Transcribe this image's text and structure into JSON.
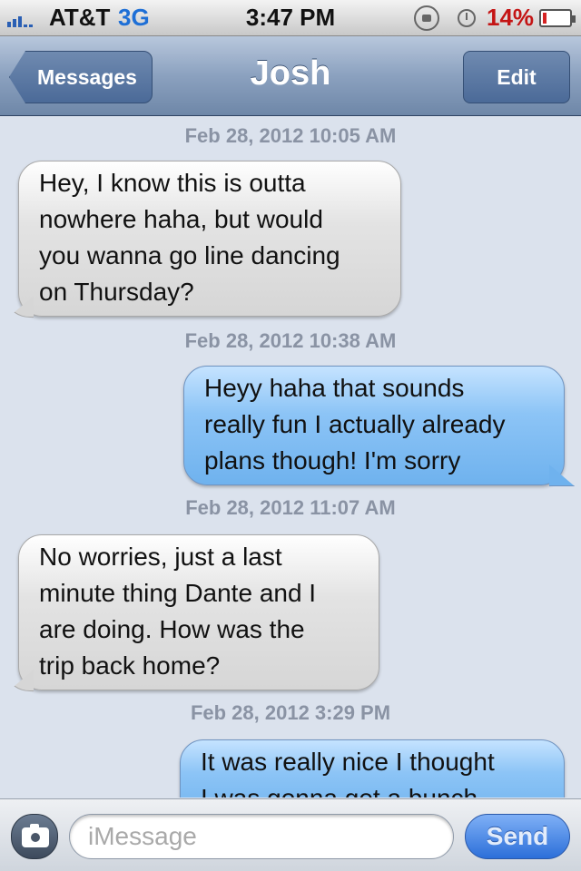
{
  "status_bar": {
    "carrier": "AT&T",
    "network": "3G",
    "time": "3:47 PM",
    "battery_percent": "14%",
    "battery_level": 0.14,
    "icons": [
      "signal-bars-icon",
      "rotation-lock-icon",
      "alarm-clock-icon",
      "battery-icon"
    ]
  },
  "nav": {
    "back_label": "Messages",
    "title": "Josh",
    "edit_label": "Edit"
  },
  "messages": [
    {
      "timestamp": "Feb 28, 2012 10:05 AM",
      "direction": "received",
      "lines": [
        "Hey, I know this is outta",
        "nowhere haha, but would",
        "you wanna go line dancing",
        " on Thursday?"
      ]
    },
    {
      "timestamp": "Feb 28, 2012 10:38 AM",
      "direction": "sent",
      "lines": [
        "Heyy haha that sounds",
        "really fun I actually already",
        "plans though! I'm sorry"
      ]
    },
    {
      "timestamp": "Feb 28, 2012 11:07 AM",
      "direction": "received",
      "lines": [
        "No worries, just a last",
        "minute thing Dante and I",
        "are doing. How was the",
        "trip back home?"
      ]
    },
    {
      "timestamp": "Feb 28, 2012 3:29 PM",
      "direction": "sent",
      "lines": [
        "It was really nice I thought",
        "I was gonna get a bunch"
      ]
    }
  ],
  "input": {
    "placeholder": "iMessage",
    "value": "",
    "send_label": "Send"
  },
  "colors": {
    "background": "#dbe2ed",
    "sent_bubble": "#8cc4f6",
    "received_bubble": "#e3e3e3",
    "battery_low": "#d42222",
    "network_3g": "#1e6fd6"
  }
}
